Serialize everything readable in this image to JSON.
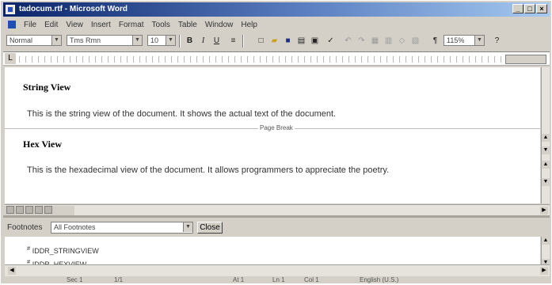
{
  "window": {
    "title": "tadocum.rtf - Microsoft Word",
    "buttons": {
      "minimize": "_",
      "maximize": "□",
      "close": "×"
    }
  },
  "menu": [
    "File",
    "Edit",
    "View",
    "Insert",
    "Format",
    "Tools",
    "Table",
    "Window",
    "Help"
  ],
  "toolbar": {
    "style": "Normal",
    "font": "Tms Rmn",
    "size": "10",
    "bold": "B",
    "italic": "I",
    "underline": "U",
    "pilcrow": "¶",
    "zoom": "115%"
  },
  "document": {
    "section1": {
      "heading": "String View",
      "body": "This is the string view of the document. It shows the actual text of the document."
    },
    "page_break": "Page Break",
    "section2": {
      "heading": "Hex View",
      "body": "This is the hexadecimal view of the document. It allows programmers to appreciate the poetry."
    }
  },
  "footnotes_pane": {
    "label": "Footnotes",
    "selector": "All Footnotes",
    "close": "Close",
    "items": [
      "IDDR_STRINGVIEW",
      "IDDR_HEXVIEW"
    ]
  },
  "status": [
    "Sec 1",
    "1/1",
    "At 1",
    "Ln 1",
    "Col 1",
    "English (U.S.)"
  ]
}
